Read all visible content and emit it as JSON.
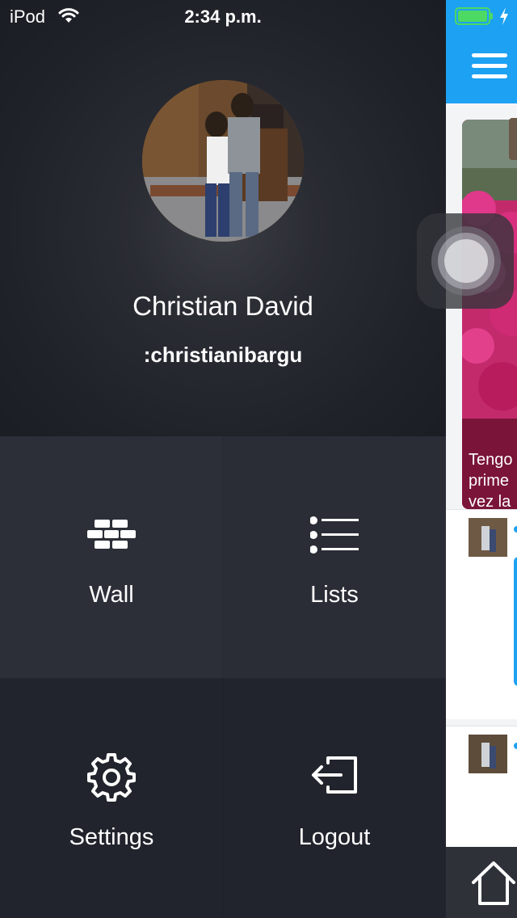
{
  "status_bar": {
    "carrier": "iPod",
    "time": "2:34 p.m.",
    "wifi_icon": "wifi-icon",
    "battery_icon": "battery-charging-icon",
    "battery_color": "#4cd964"
  },
  "profile": {
    "name": "Christian David",
    "handle": ":christianibargu"
  },
  "menu": {
    "wall": {
      "label": "Wall",
      "icon": "brick-wall-icon"
    },
    "lists": {
      "label": "Lists",
      "icon": "list-icon"
    },
    "settings": {
      "label": "Settings",
      "icon": "gear-icon"
    },
    "logout": {
      "label": "Logout",
      "icon": "logout-icon"
    }
  },
  "main_peek": {
    "accent_color": "#1da1f2",
    "post_caption_lines": [
      "Tengo",
      "prime",
      "vez la"
    ],
    "header_icon": "hamburger-menu-icon",
    "tab_icon": "home-icon"
  }
}
